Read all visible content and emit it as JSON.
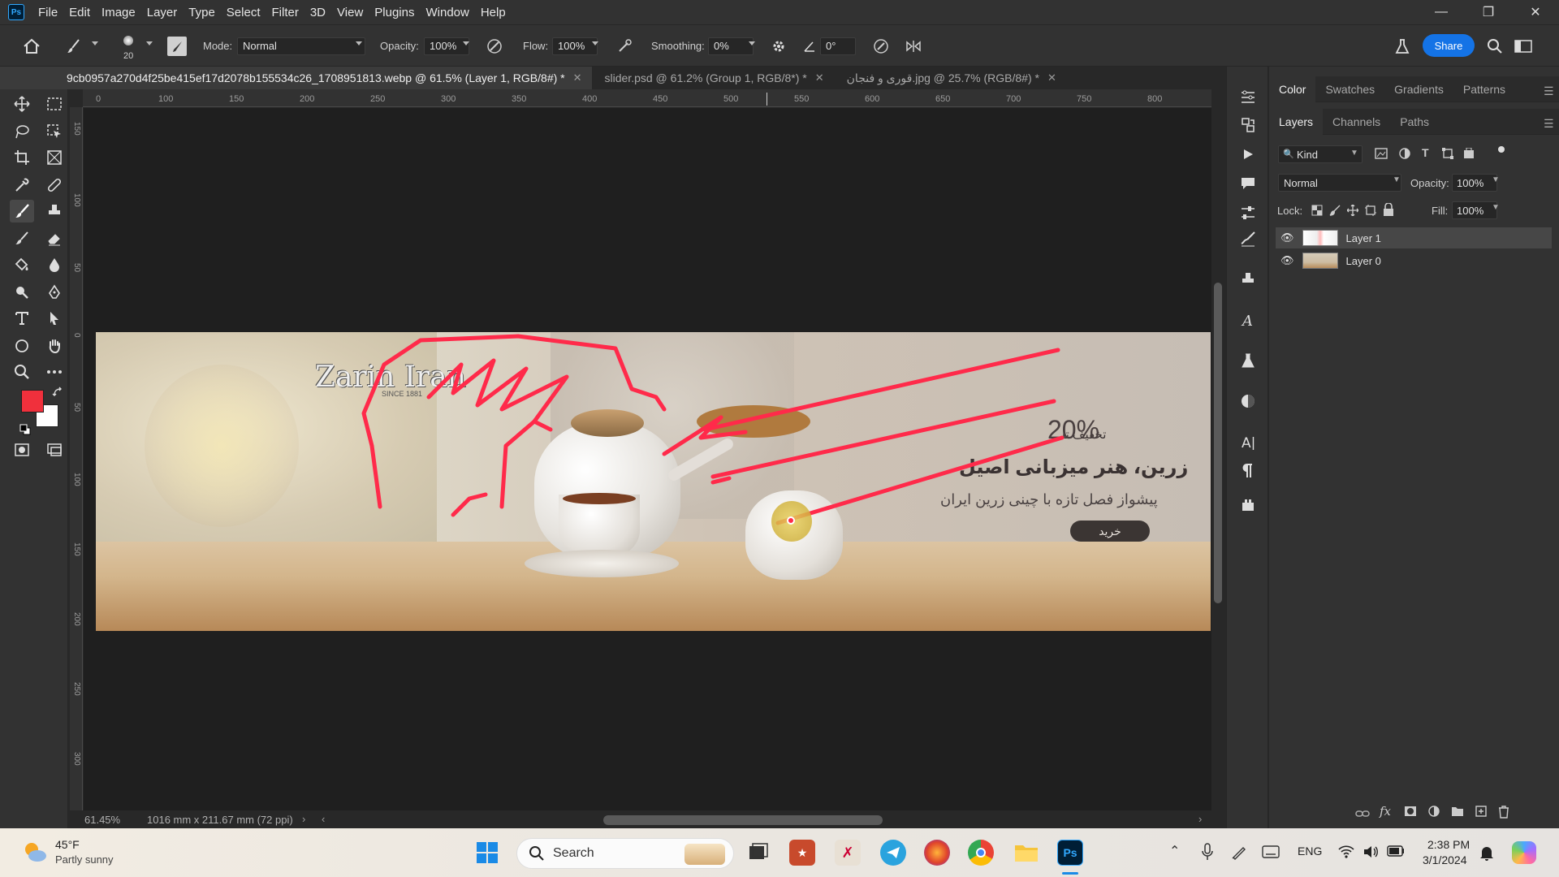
{
  "app": {
    "logo": "Ps"
  },
  "menu": [
    "File",
    "Edit",
    "Image",
    "Layer",
    "Type",
    "Select",
    "Filter",
    "3D",
    "View",
    "Plugins",
    "Window",
    "Help"
  ],
  "options": {
    "brush_size": "20",
    "mode_label": "Mode:",
    "mode_value": "Normal",
    "opacity_label": "Opacity:",
    "opacity_value": "100%",
    "flow_label": "Flow:",
    "flow_value": "100%",
    "smoothing_label": "Smoothing:",
    "smoothing_value": "0%",
    "angle_value": "0°",
    "share_label": "Share"
  },
  "tabs": [
    {
      "title": "9cb0957a270d4f25be415ef17d2078b155534c26_1708951813.webp @ 61.5% (Layer 1, RGB/8#) *",
      "active": true
    },
    {
      "title": "slider.psd @ 61.2% (Group 1, RGB/8*) *",
      "active": false
    },
    {
      "title": "قوری و فنجان.jpg @ 25.7% (RGB/8#) *",
      "active": false
    }
  ],
  "ruler_top": [
    "0",
    "100",
    "150",
    "200",
    "250",
    "300",
    "350",
    "400",
    "450",
    "500",
    "550",
    "600",
    "650",
    "700",
    "750",
    "800"
  ],
  "ruler_left": [
    "150",
    "100",
    "50",
    "0",
    "50",
    "100",
    "150",
    "200",
    "250",
    "300"
  ],
  "banner": {
    "logo": "Zarin Iran",
    "logo_since": "SINCE 1881",
    "discount_prefix": "تخفیف تا",
    "discount": "20%",
    "headline": "زرین، هنر میزبانی اصیل",
    "subline": "پیشواز فصل تازه با چینی زرین ایران",
    "button": "خرید"
  },
  "status": {
    "zoom": "61.45%",
    "doc_size": "1016 mm x 211.67 mm (72 ppi)"
  },
  "panels": {
    "top_tabs": [
      "Color",
      "Swatches",
      "Gradients",
      "Patterns"
    ],
    "layer_tabs": [
      "Layers",
      "Channels",
      "Paths"
    ],
    "kind_label": "Kind",
    "blend_mode": "Normal",
    "opacity_label": "Opacity:",
    "opacity_value": "100%",
    "lock_label": "Lock:",
    "fill_label": "Fill:",
    "fill_value": "100%",
    "layers": [
      {
        "name": "Layer 1",
        "selected": true
      },
      {
        "name": "Layer 0",
        "selected": false
      }
    ]
  },
  "colors": {
    "foreground": "#f0303c",
    "background": "#ffffff",
    "accent": "#1473e6",
    "annotation": "#ff2a4a"
  },
  "taskbar": {
    "weather_temp": "45°F",
    "weather_desc": "Partly sunny",
    "search_placeholder": "Search",
    "language": "ENG",
    "time": "2:38 PM",
    "date": "3/1/2024"
  }
}
